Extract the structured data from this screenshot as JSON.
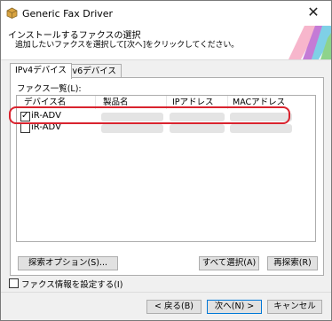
{
  "window": {
    "title": "Generic Fax Driver",
    "close_glyph": "✕"
  },
  "header": {
    "title": "インストールするファクスの選択",
    "subtitle": "追加したいファクスを選択して[次へ]をクリックしてください。"
  },
  "tabs": [
    {
      "label": "IPv4デバイス",
      "active": true
    },
    {
      "label": "IPv6デバイス",
      "active": false
    }
  ],
  "list": {
    "label": "ファクス一覧(L):",
    "columns": [
      "デバイス名",
      "製品名",
      "IPアドレス",
      "MACアドレス"
    ],
    "rows": [
      {
        "name": "iR-ADV",
        "checked": true
      },
      {
        "name": "iR-ADV",
        "checked": false
      }
    ]
  },
  "buttons": {
    "search_options": "探索オプション(S)...",
    "select_all": "すべて選択(A)",
    "research": "再探索(R)",
    "back": "< 戻る(B)",
    "next": "次へ(N) >",
    "cancel": "キャンセル"
  },
  "checkbox_fax_info": {
    "label": "ファクス情報を設定する(I)",
    "checked": false
  },
  "colors": {
    "highlight": "#d9232e",
    "default_button_border": "#0078d7"
  }
}
